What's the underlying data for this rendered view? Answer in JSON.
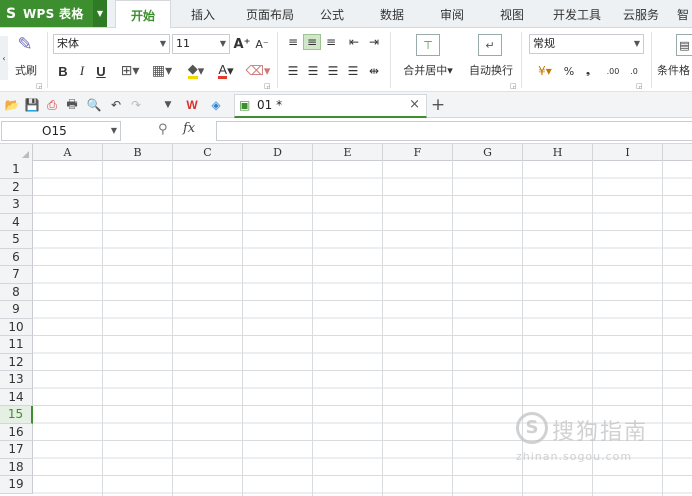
{
  "app": {
    "name": "WPS 表格",
    "logo": "S",
    "accent": "#3d8e2f"
  },
  "menu_tabs": [
    "开始",
    "插入",
    "页面布局",
    "公式",
    "数据",
    "审阅",
    "视图",
    "开发工具",
    "云服务",
    "智"
  ],
  "active_tab": "开始",
  "ribbon": {
    "format_painter_label": "式刷",
    "font_name": "宋体",
    "font_size": "11",
    "grow_font": "A⁺",
    "shrink_font": "A⁻",
    "bold": "B",
    "italic": "I",
    "underline": "U",
    "merge_center_label": "合并居中",
    "wrap_text_label": "自动换行",
    "number_format": "常规",
    "percent": "%",
    "comma": "❟",
    "inc_decimal": ".00",
    "dec_decimal": ".0",
    "conditional_format_label": "条件格"
  },
  "doc_tab": {
    "name": "01 *"
  },
  "formula_bar": {
    "cell_ref": "O15",
    "fx": "fx",
    "content": ""
  },
  "columns": [
    "A",
    "B",
    "C",
    "D",
    "E",
    "F",
    "G",
    "H",
    "I"
  ],
  "rows": [
    "1",
    "2",
    "3",
    "4",
    "5",
    "6",
    "7",
    "8",
    "9",
    "10",
    "11",
    "12",
    "13",
    "14",
    "15",
    "16",
    "17",
    "18",
    "19"
  ],
  "active_row": "15",
  "watermark": {
    "logo": "S",
    "title": "搜狗指南",
    "url": "zhinan.sogou.com"
  }
}
